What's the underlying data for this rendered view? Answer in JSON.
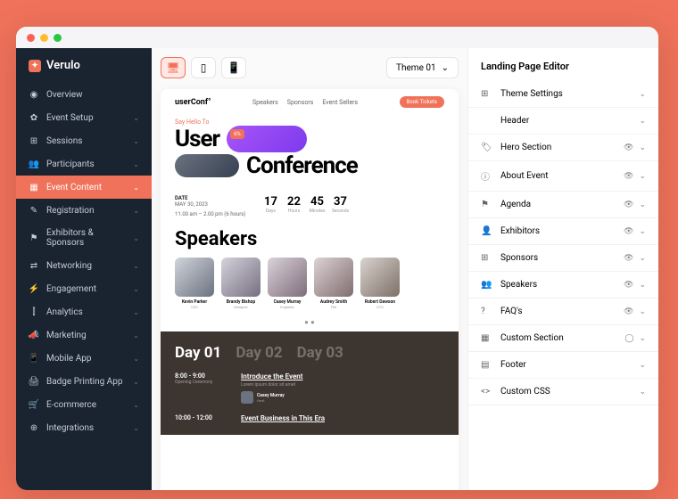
{
  "brand": "Verulo",
  "nav": [
    {
      "icon": "◉",
      "label": "Overview",
      "expandable": false
    },
    {
      "icon": "✿",
      "label": "Event Setup",
      "expandable": true
    },
    {
      "icon": "⊞",
      "label": "Sessions",
      "expandable": true
    },
    {
      "icon": "👥",
      "label": "Participants",
      "expandable": true
    },
    {
      "icon": "▦",
      "label": "Event Content",
      "expandable": true,
      "active": true
    },
    {
      "icon": "✎",
      "label": "Registration",
      "expandable": true
    },
    {
      "icon": "⚑",
      "label": "Exhibitors & Sponsors",
      "expandable": true
    },
    {
      "icon": "⇄",
      "label": "Networking",
      "expandable": true
    },
    {
      "icon": "⚡",
      "label": "Engagement",
      "expandable": true
    },
    {
      "icon": "⫿",
      "label": "Analytics",
      "expandable": true
    },
    {
      "icon": "📣",
      "label": "Marketing",
      "expandable": true
    },
    {
      "icon": "📱",
      "label": "Mobile App",
      "expandable": true
    },
    {
      "icon": "🖨",
      "label": "Badge Printing App",
      "expandable": true
    },
    {
      "icon": "🛒",
      "label": "E-commerce",
      "expandable": true
    },
    {
      "icon": "⊕",
      "label": "Integrations",
      "expandable": true
    }
  ],
  "theme_selector": "Theme 01",
  "canvas": {
    "brand": "userConf°",
    "navlinks": [
      "Speakers",
      "Sponsors",
      "Event Sellers"
    ],
    "cta": "Book Tickets",
    "hero_tag": "Say Hello To",
    "hero_line1": "User",
    "hero_line2": "Conference",
    "badge": "6%",
    "date_label": "DATE",
    "date_value": "MAY 30, 2023",
    "time_value": "11.00 am – 2.00 pm (6 hours)",
    "countdown": [
      {
        "n": "17",
        "l": "Days"
      },
      {
        "n": "22",
        "l": "Hours"
      },
      {
        "n": "45",
        "l": "Minutes"
      },
      {
        "n": "37",
        "l": "Seconds"
      }
    ],
    "speakers_title": "Speakers",
    "speakers": [
      {
        "name": "Kevin Parker",
        "role": "CEO"
      },
      {
        "name": "Brandy Bishop",
        "role": "Designer"
      },
      {
        "name": "Casey Murray",
        "role": "Engineer"
      },
      {
        "name": "Audrey Smith",
        "role": "PM"
      },
      {
        "name": "Robert Dawson",
        "role": "CTO"
      }
    ],
    "days": [
      "Day 01",
      "Day 02",
      "Day 03"
    ],
    "slots": [
      {
        "time": "8:00 - 9:00",
        "sub": "Opening Ceremony",
        "title": "Introduce the Event",
        "desc": "Lorem ipsum dolor sit amet",
        "speaker": "Casey Murray",
        "role": "Host"
      },
      {
        "time": "10:00 - 12:00",
        "sub": "",
        "title": "Event Business in This Era"
      }
    ]
  },
  "rpanel": {
    "title": "Landing Page Editor",
    "items": [
      {
        "icon": "⊞",
        "label": "Theme Settings",
        "vis": false
      },
      {
        "icon": "</>",
        "label": "Header",
        "vis": false
      },
      {
        "icon": "🏷",
        "label": "Hero Section",
        "vis": true
      },
      {
        "icon": "ⓘ",
        "label": "About Event",
        "vis": true
      },
      {
        "icon": "⚑",
        "label": "Agenda",
        "vis": true
      },
      {
        "icon": "👤",
        "label": "Exhibitors",
        "vis": true
      },
      {
        "icon": "⊞",
        "label": "Sponsors",
        "vis": true
      },
      {
        "icon": "👥",
        "label": "Speakers",
        "vis": true
      },
      {
        "icon": "?",
        "label": "FAQ's",
        "vis": true
      },
      {
        "icon": "▦",
        "label": "Custom Section",
        "vis": true,
        "hidden": true
      },
      {
        "icon": "▤",
        "label": "Footer",
        "vis": false
      },
      {
        "icon": "<>",
        "label": "Custom CSS",
        "vis": false
      }
    ]
  }
}
